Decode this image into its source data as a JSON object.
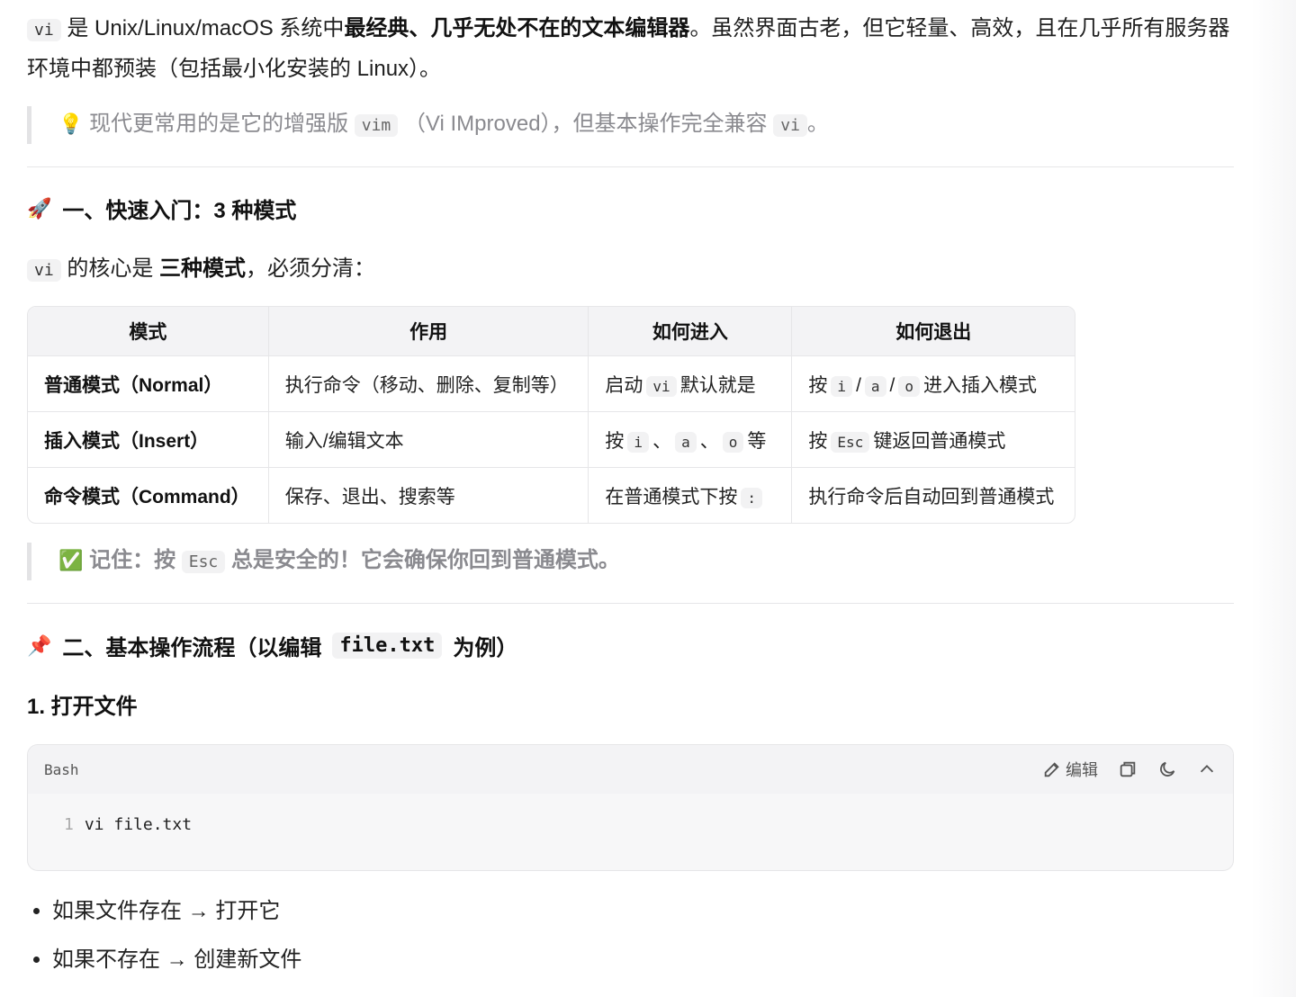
{
  "intro": {
    "code_vi": "vi",
    "text_a": " 是 Unix/Linux/macOS 系统中",
    "bold": "最经典、几乎无处不在的文本编辑器",
    "text_b": "。虽然界面古老，但它轻量、高效，且在几乎所有服务器环境中都预装（包括最小化安装的 Linux）。"
  },
  "tip1": {
    "icon": "lightbulb-icon",
    "text_a": "现代更常用的是它的增强版",
    "code_vim": "vim",
    "text_b": "（Vi IMproved），但基本操作完全兼容",
    "code_vi": "vi",
    "text_c": "。"
  },
  "section1": {
    "icon": "rocket-icon",
    "title": "一、快速入门：3 种模式"
  },
  "core": {
    "code_vi": "vi",
    "text_a": " 的核心是 ",
    "bold": "三种模式",
    "text_b": "，必须分清："
  },
  "table": {
    "headers": [
      "模式",
      "作用",
      "如何进入",
      "如何退出"
    ],
    "rows": [
      {
        "mode": "普通模式（Normal）",
        "purpose": "执行命令（移动、删除、复制等）",
        "enter": {
          "a": "启动",
          "code": "vi",
          "b": "默认就是"
        },
        "exit": {
          "a": "按",
          "k1": "i",
          "s1": "/",
          "k2": "a",
          "s2": "/",
          "k3": "o",
          "b": "进入插入模式"
        }
      },
      {
        "mode": "插入模式（Insert）",
        "purpose": "输入/编辑文本",
        "enter": {
          "a": "按",
          "k1": "i",
          "s1": "、",
          "k2": "a",
          "s2": "、",
          "k3": "o",
          "b": "等"
        },
        "exit": {
          "a": "按",
          "code": "Esc",
          "b": "键返回普通模式"
        }
      },
      {
        "mode": "命令模式（Command）",
        "purpose": "保存、退出、搜索等",
        "enter": {
          "a": "在普通模式下按",
          "code": ":"
        },
        "exit": {
          "a": "执行命令后自动回到普通模式"
        }
      }
    ]
  },
  "tip2": {
    "icon": "check-box-icon",
    "text_a": "记住：按",
    "code": "Esc",
    "text_b": "总是安全的！它会确保你回到普通模式。"
  },
  "section2": {
    "icon": "pushpin-icon",
    "title_a": "二、基本操作流程（以编辑",
    "code": "file.txt",
    "title_b": "为例）"
  },
  "step1": {
    "title": "1. 打开文件"
  },
  "codeblock": {
    "lang": "Bash",
    "edit_label": "编辑",
    "line_no": "1",
    "code": "vi file.txt"
  },
  "bullets": [
    "如果文件存在 → 打开它",
    "如果不存在 → 创建新文件"
  ]
}
